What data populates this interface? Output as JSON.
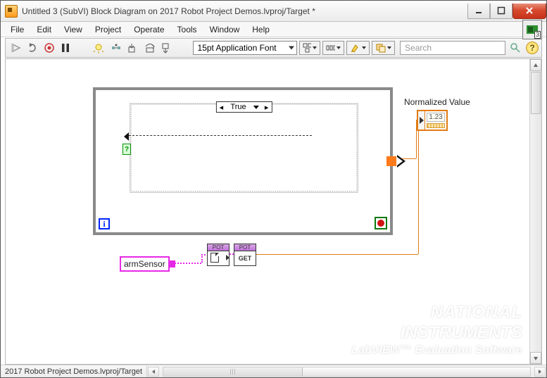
{
  "title": "Untitled 3 (SubVI) Block Diagram on 2017 Robot Project Demos.lvproj/Target *",
  "menu": {
    "file": "File",
    "edit": "Edit",
    "view": "View",
    "project": "Project",
    "operate": "Operate",
    "tools": "Tools",
    "window": "Window",
    "help": "Help"
  },
  "toolbar": {
    "font": "15pt Application Font",
    "search_placeholder": "Search",
    "corner_badge": "3"
  },
  "diagram": {
    "case_selector": "True",
    "normalized_label": "Normalized Value",
    "normalized_value": "1.23",
    "armSensor_label": "armSensor",
    "subvi_top": "POT",
    "subvi_get": "GET",
    "while_i": "i"
  },
  "watermark": {
    "line1_a": "NATIONAL",
    "line1_b": "INSTRUMENTS",
    "line2": "LabVIEW™ Evaluation Software"
  },
  "statusbar": {
    "path": "2017 Robot Project Demos.lvproj/Target"
  }
}
